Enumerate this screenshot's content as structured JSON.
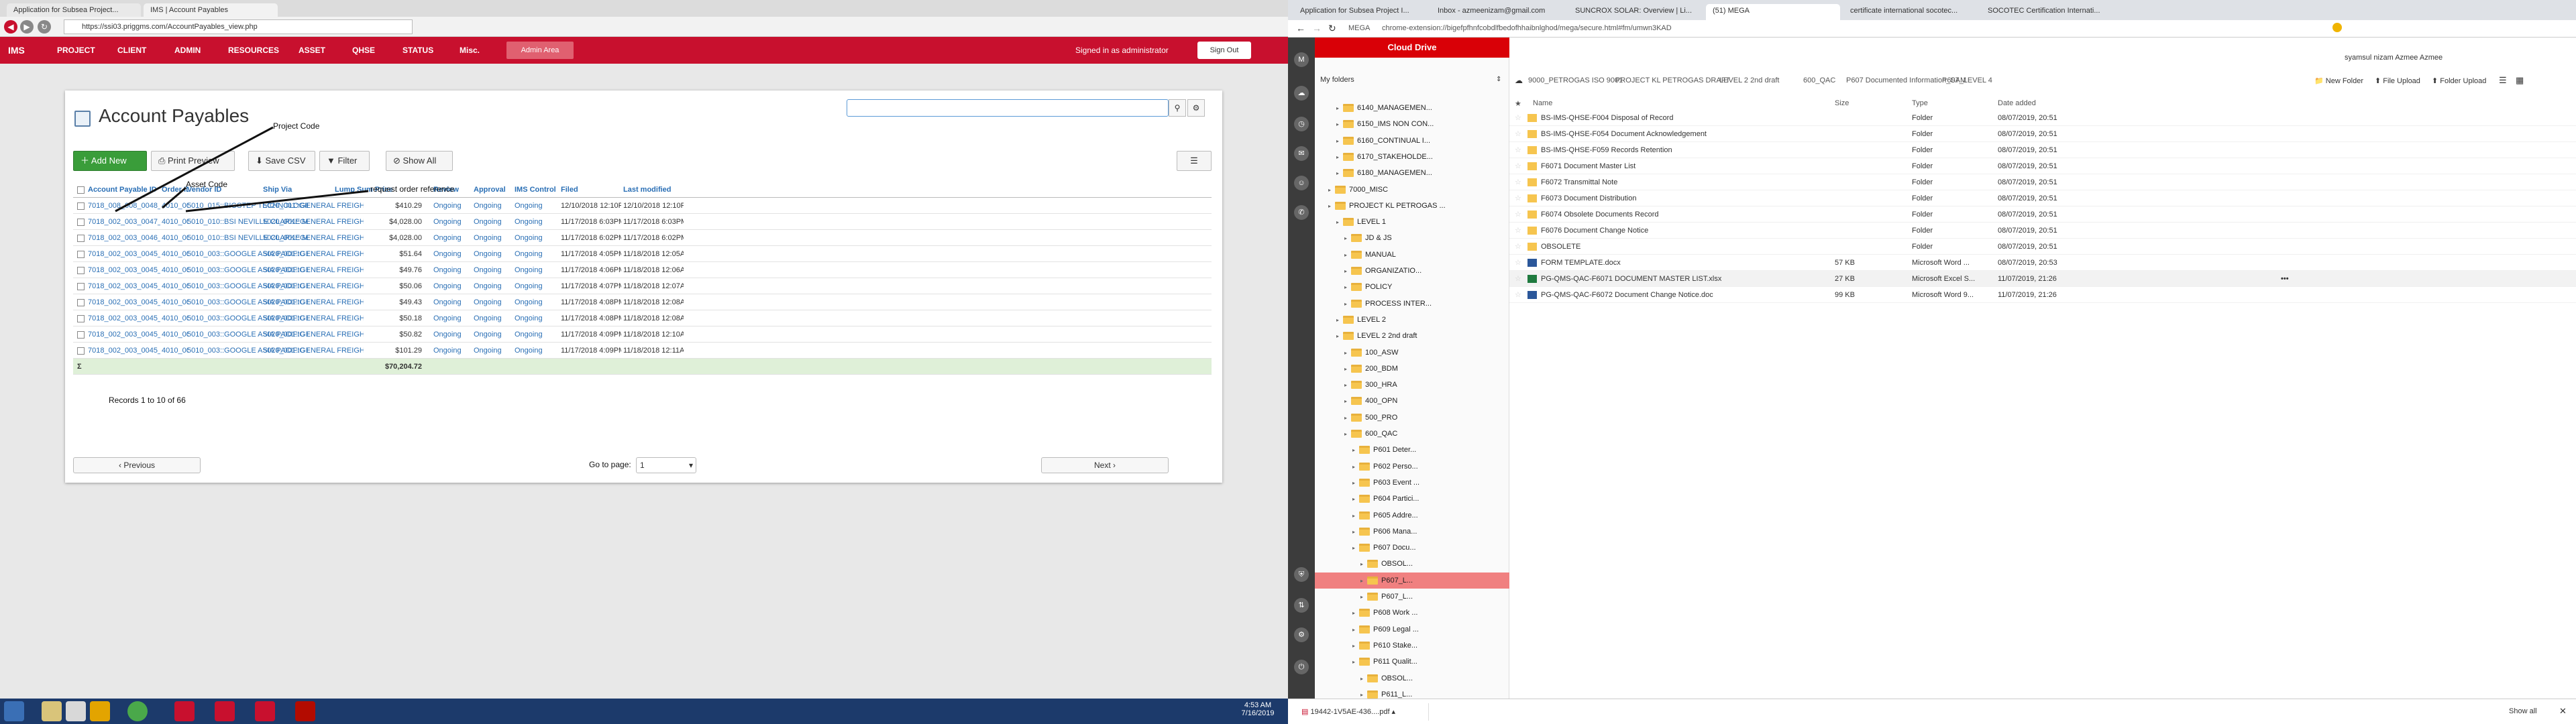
{
  "left_browser": {
    "tabs": [
      "Application for Subsea Project...",
      "IMS | Account Payables"
    ],
    "url": "https://ssi03.priggms.com/AccountPayables_view.php",
    "nav": {
      "brand": "IMS",
      "menus": [
        "PROJECT",
        "CLIENT",
        "ADMIN",
        "RESOURCES",
        "ASSET",
        "QHSE",
        "STATUS",
        "Misc."
      ],
      "admin_area": "Admin Area",
      "signed_in": "Signed in as administrator",
      "sign_out": "Sign Out"
    },
    "page_title": "Account Payables",
    "toolbar": {
      "add": "Add New",
      "print": "Print Preview",
      "csv": "Save CSV",
      "filter": "Filter",
      "showall": "Show All"
    },
    "headers": [
      "Account Payable ID",
      "Order ID",
      "Vendor ID",
      "Ship Via",
      "Lump Sum Price",
      "Review",
      "Approval",
      "IMS Control",
      "Filed",
      "Last modified"
    ],
    "rows": [
      [
        "7018_008_008_0048_001",
        "4010_0048",
        "5010_015::BIGSTEP TECHNOLOGIES PVT LTD.",
        "5020_001::GENERAL FREIGHT AGENT",
        "$410.29",
        "Ongoing",
        "Ongoing",
        "Ongoing",
        "12/10/2018 12:10PM",
        "12/10/2018 12:10PM"
      ],
      [
        "7018_002_003_0047_001",
        "4010_0047",
        "5010_010::BSI NEVILLE CLARKE M SDN BHD",
        "5020_001::GENERAL FREIGHT AGENT",
        "$4,028.00",
        "Ongoing",
        "Ongoing",
        "Ongoing",
        "11/17/2018 6:03PM",
        "11/17/2018 6:03PM"
      ],
      [
        "7018_002_003_0046_001",
        "4010_0046",
        "5010_010::BSI NEVILLE CLARKE M SDN BHD",
        "5020_001::GENERAL FREIGHT AGENT",
        "$4,028.00",
        "Ongoing",
        "Ongoing",
        "Ongoing",
        "11/17/2018 6:02PM",
        "11/17/2018 6:02PM"
      ],
      [
        "7018_002_003_0045_001",
        "4010_0045",
        "5010_003::GOOGLE ASIA PACIFIC PLT. LTD.",
        "5020_001::GENERAL FREIGHT AGENT",
        "$51.64",
        "Ongoing",
        "Ongoing",
        "Ongoing",
        "11/17/2018 4:05PM",
        "11/18/2018 12:05AM"
      ],
      [
        "7018_002_003_0045_002",
        "4010_0045",
        "5010_003::GOOGLE ASIA PACIFIC PLT. LTD.",
        "5020_001::GENERAL FREIGHT AGENT",
        "$49.76",
        "Ongoing",
        "Ongoing",
        "Ongoing",
        "11/17/2018 4:06PM",
        "11/18/2018 12:06AM"
      ],
      [
        "7018_002_003_0045_003",
        "4010_0045",
        "5010_003::GOOGLE ASIA PACIFIC PLT. LTD.",
        "5020_001::GENERAL FREIGHT AGENT",
        "$50.06",
        "Ongoing",
        "Ongoing",
        "Ongoing",
        "11/17/2018 4:07PM",
        "11/18/2018 12:07AM"
      ],
      [
        "7018_002_003_0045_004",
        "4010_0045",
        "5010_003::GOOGLE ASIA PACIFIC PLT. LTD.",
        "5020_001::GENERAL FREIGHT AGENT",
        "$49.43",
        "Ongoing",
        "Ongoing",
        "Ongoing",
        "11/17/2018 4:08PM",
        "11/18/2018 12:08AM"
      ],
      [
        "7018_002_003_0045_005",
        "4010_0045",
        "5010_003::GOOGLE ASIA PACIFIC PLT. LTD.",
        "5020_001::GENERAL FREIGHT AGENT",
        "$50.18",
        "Ongoing",
        "Ongoing",
        "Ongoing",
        "11/17/2018 4:08PM",
        "11/18/2018 12:08AM"
      ],
      [
        "7018_002_003_0045_006",
        "4010_0045",
        "5010_003::GOOGLE ASIA PACIFIC PLT. LTD.",
        "5020_001::GENERAL FREIGHT AGENT",
        "$50.82",
        "Ongoing",
        "Ongoing",
        "Ongoing",
        "11/17/2018 4:09PM",
        "11/18/2018 12:10AM"
      ],
      [
        "7018_002_003_0045_007",
        "4010_0045",
        "5010_003::GOOGLE ASIA PACIFIC PLT. LTD.",
        "5020_001::GENERAL FREIGHT AGENT",
        "$101.29",
        "Ongoing",
        "Ongoing",
        "Ongoing",
        "11/17/2018 4:09PM",
        "11/18/2018 12:11AM"
      ]
    ],
    "total": "$70,204.72",
    "sum_symbol": "Σ",
    "records": "Records 1 to 10 of 66",
    "prev": "Previous",
    "next": "Next",
    "goto": "Go to page:",
    "page_value": "1",
    "annotations": {
      "project_code": "Project Code",
      "asset_code": "Asset Code",
      "request_order": "request order reference"
    }
  },
  "right_browser": {
    "tabs": [
      "Application for Subsea Project I...",
      "Inbox - azmeenizam@gmail.com",
      "SUNCROX SOLAR: Overview | Li...",
      "(51) MEGA",
      "certificate international socotec...",
      "SOCOTEC Certification Internati..."
    ],
    "url": "chrome-extension://bigefpfhnfcobdlfbedofhhaibnlghod/mega/secure.html#fm/umwn3KAD",
    "url_prefix": "MEGA",
    "user": "syamsul nizam Azmee Azmee",
    "cloud_drive": "Cloud Drive",
    "my_folders": "My folders",
    "breadcrumb": [
      "9000_PETROGAS ISO 9001",
      "PROJECT KL PETROGAS DRAFT",
      "LEVEL 2 2nd draft",
      "600_QAC",
      "P607 Documented Information_SAM",
      "P607_LEVEL 4"
    ],
    "actions": {
      "new_folder": "New Folder",
      "file_upload": "File Upload",
      "folder_upload": "Folder Upload"
    },
    "tree": [
      "6140_MANAGEMEN...",
      "6150_IMS NON CON...",
      "6160_CONTINUAL I...",
      "6170_STAKEHOLDE...",
      "6180_MANAGEMEN...",
      "7000_MISC",
      "PROJECT KL PETROGAS ...",
      "LEVEL 1",
      "JD & JS",
      "MANUAL",
      "ORGANIZATIO...",
      "POLICY",
      "PROCESS INTER...",
      "LEVEL 2",
      "LEVEL 2 2nd draft",
      "100_ASW",
      "200_BDM",
      "300_HRA",
      "400_OPN",
      "500_PRO",
      "600_QAC",
      "P601 Deter...",
      "P602 Perso...",
      "P603 Event ...",
      "P604 Partici...",
      "P605 Addre...",
      "P606 Mana...",
      "P607 Docu...",
      "OBSOL...",
      "P607_L...",
      "P607_L...",
      "P608 Work ...",
      "P609 Legal ...",
      "P610 Stake...",
      "P611 Qualit...",
      "OBSOL...",
      "P611_L..."
    ],
    "columns": [
      "Name",
      "Size",
      "Type",
      "Date added"
    ],
    "files": [
      [
        "BS-IMS-QHSE-F004 Disposal of Record",
        "",
        "Folder",
        "08/07/2019, 20:51"
      ],
      [
        "BS-IMS-QHSE-F054 Document Acknowledgement",
        "",
        "Folder",
        "08/07/2019, 20:51"
      ],
      [
        "BS-IMS-QHSE-F059 Records Retention",
        "",
        "Folder",
        "08/07/2019, 20:51"
      ],
      [
        "F6071 Document Master List",
        "",
        "Folder",
        "08/07/2019, 20:51"
      ],
      [
        "F6072 Transmittal Note",
        "",
        "Folder",
        "08/07/2019, 20:51"
      ],
      [
        "F6073 Document Distribution",
        "",
        "Folder",
        "08/07/2019, 20:51"
      ],
      [
        "F6074 Obsolete Documents Record",
        "",
        "Folder",
        "08/07/2019, 20:51"
      ],
      [
        "F6076 Document Change Notice",
        "",
        "Folder",
        "08/07/2019, 20:51"
      ],
      [
        "OBSOLETE",
        "",
        "Folder",
        "08/07/2019, 20:51"
      ],
      [
        "FORM TEMPLATE.docx",
        "57 KB",
        "Microsoft Word ...",
        "08/07/2019, 20:53"
      ],
      [
        "PG-QMS-QAC-F6071 DOCUMENT MASTER LIST.xlsx",
        "27 KB",
        "Microsoft Excel S...",
        "11/07/2019, 21:26"
      ],
      [
        "PG-QMS-QAC-F6072 Document Change Notice.doc",
        "99 KB",
        "Microsoft Word 9...",
        "11/07/2019, 21:26"
      ]
    ],
    "download": "19442-1V5AE-436....pdf",
    "show_all": "Show all"
  },
  "taskbar": {
    "time": "4:53 AM",
    "date": "7/16/2019"
  },
  "colors": {
    "brand_red": "#c8102e",
    "mega_red": "#d90007",
    "link": "#2a6fb5",
    "green": "#3a9d3a"
  }
}
